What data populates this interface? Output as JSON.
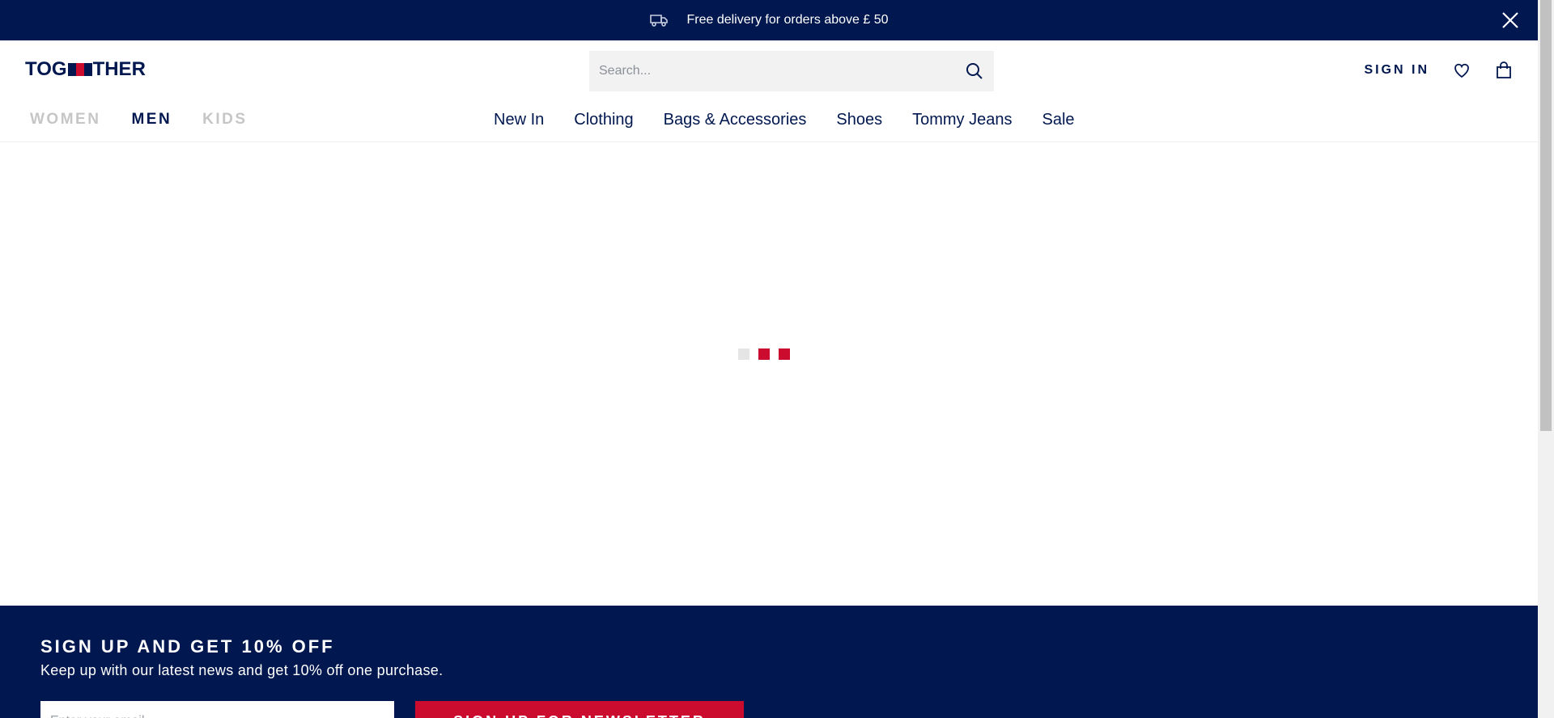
{
  "promo": {
    "text": "Free delivery for orders above £ 50",
    "icon": "delivery-truck-icon",
    "close_icon": "close-icon"
  },
  "header": {
    "logo_text_left": "TOG",
    "logo_text_right": "THER",
    "search_placeholder": "Search...",
    "sign_in": "SIGN IN",
    "wishlist_icon": "heart-icon",
    "bag_icon": "shopping-bag-icon"
  },
  "gender_nav": [
    {
      "label": "WOMEN",
      "active": false
    },
    {
      "label": "MEN",
      "active": true
    },
    {
      "label": "KIDS",
      "active": false
    }
  ],
  "category_nav": [
    "New In",
    "Clothing",
    "Bags & Accessories",
    "Shoes",
    "Tommy Jeans",
    "Sale"
  ],
  "loader": {
    "colors": [
      "#e5e5e5",
      "#cc0c2f",
      "#cc0c2f"
    ]
  },
  "newsletter": {
    "title": "SIGN UP AND GET 10% OFF",
    "subtitle": "Keep up with our latest news and get 10% off one purchase.",
    "email_placeholder": "Enter your email",
    "button": "SIGN UP FOR NEWSLETTER"
  },
  "colors": {
    "navy": "#00174f",
    "red": "#cc0c2f",
    "muted": "#c6c6c6"
  }
}
